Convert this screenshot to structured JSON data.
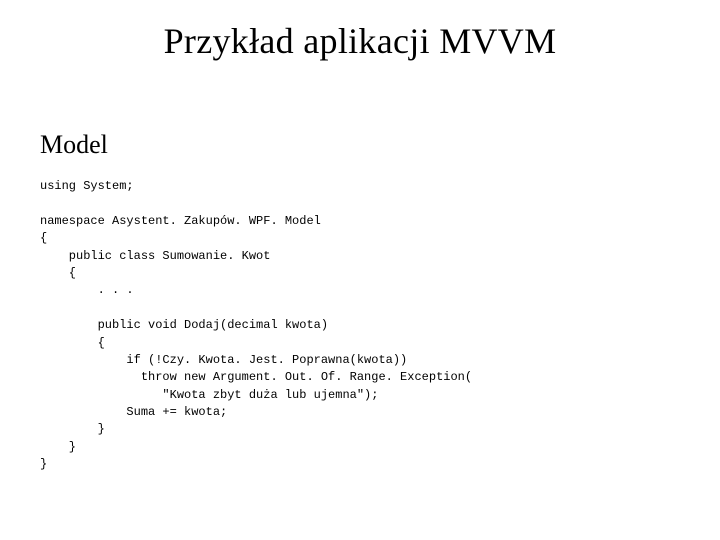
{
  "title": "Przykład aplikacji MVVM",
  "subheading": "Model",
  "code": {
    "l01": "using System;",
    "l02": "",
    "l03": "namespace Asystent. Zakupów. WPF. Model",
    "l04": "{",
    "l05": "    public class Sumowanie. Kwot",
    "l06": "    {",
    "l07": "        . . .",
    "l08": "",
    "l09": "        public void Dodaj(decimal kwota)",
    "l10": "        {",
    "l11": "            if (!Czy. Kwota. Jest. Poprawna(kwota))",
    "l12": "              throw new Argument. Out. Of. Range. Exception(",
    "l13": "                 \"Kwota zbyt duża lub ujemna\");",
    "l14": "            Suma += kwota;",
    "l15": "        }",
    "l16": "    }",
    "l17": "}"
  }
}
